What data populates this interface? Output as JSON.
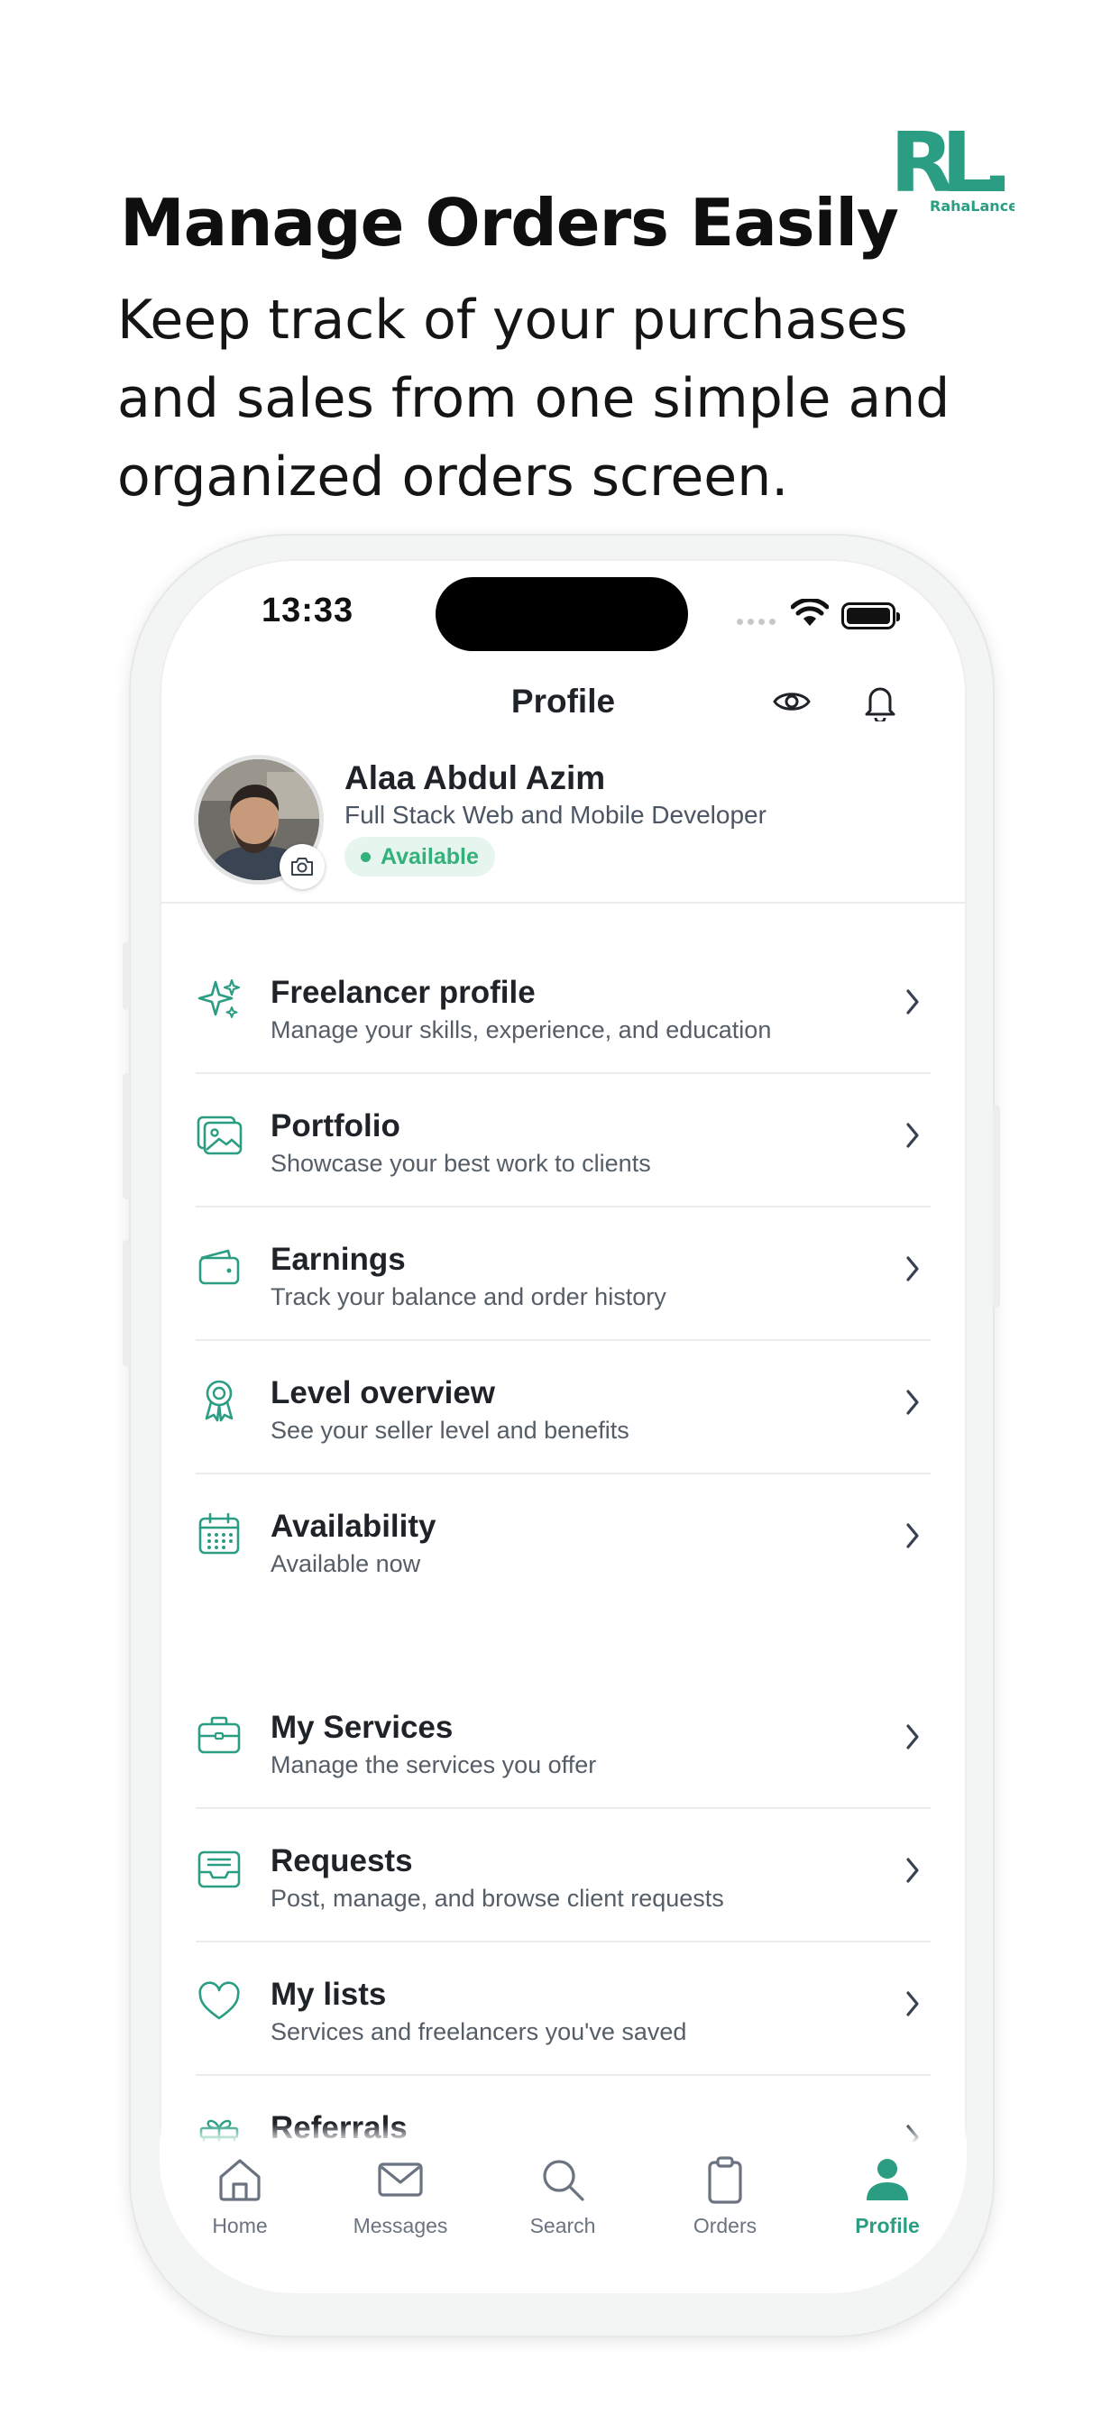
{
  "promo": {
    "headline": "Manage Orders Easily",
    "subhead": "Keep track of your purchases and sales from one simple and organized orders screen.",
    "logo_mark": "RL.",
    "logo_text": "RahaLancer"
  },
  "colors": {
    "accent": "#2a9d82",
    "available": "#34b07a",
    "available_bg": "#e6f6ee",
    "text_primary": "#1f2328",
    "text_secondary": "#555d66",
    "tab_inactive": "#6b7280"
  },
  "status_bar": {
    "time": "13:33",
    "icons": [
      "signal-dots-icon",
      "wifi-icon",
      "battery-icon"
    ]
  },
  "header": {
    "title": "Profile",
    "actions": [
      "eye-icon",
      "bell-icon"
    ]
  },
  "profile": {
    "name": "Alaa Abdul Azim",
    "role": "Full Stack Web and Mobile Developer",
    "status": "Available"
  },
  "menu": [
    {
      "icon": "sparkles-icon",
      "title": "Freelancer profile",
      "subtitle": "Manage your skills, experience, and education"
    },
    {
      "icon": "images-icon",
      "title": "Portfolio",
      "subtitle": "Showcase your best work to clients"
    },
    {
      "icon": "wallet-icon",
      "title": "Earnings",
      "subtitle": "Track your balance and order history"
    },
    {
      "icon": "award-icon",
      "title": "Level overview",
      "subtitle": "See your seller level and benefits"
    },
    {
      "icon": "calendar-icon",
      "title": "Availability",
      "subtitle": "Available now"
    },
    {
      "icon": "briefcase-icon",
      "title": "My Services",
      "subtitle": "Manage the services you offer"
    },
    {
      "icon": "inbox-icon",
      "title": "Requests",
      "subtitle": "Post, manage, and browse client requests"
    },
    {
      "icon": "heart-icon",
      "title": "My lists",
      "subtitle": "Services and freelancers you've saved"
    },
    {
      "icon": "gift-icon",
      "title": "Referrals",
      "subtitle": ""
    }
  ],
  "tabs": [
    {
      "icon": "home-icon",
      "label": "Home",
      "active": false
    },
    {
      "icon": "mail-icon",
      "label": "Messages",
      "active": false
    },
    {
      "icon": "search-icon",
      "label": "Search",
      "active": false
    },
    {
      "icon": "clipboard-icon",
      "label": "Orders",
      "active": false
    },
    {
      "icon": "user-icon",
      "label": "Profile",
      "active": true
    }
  ]
}
